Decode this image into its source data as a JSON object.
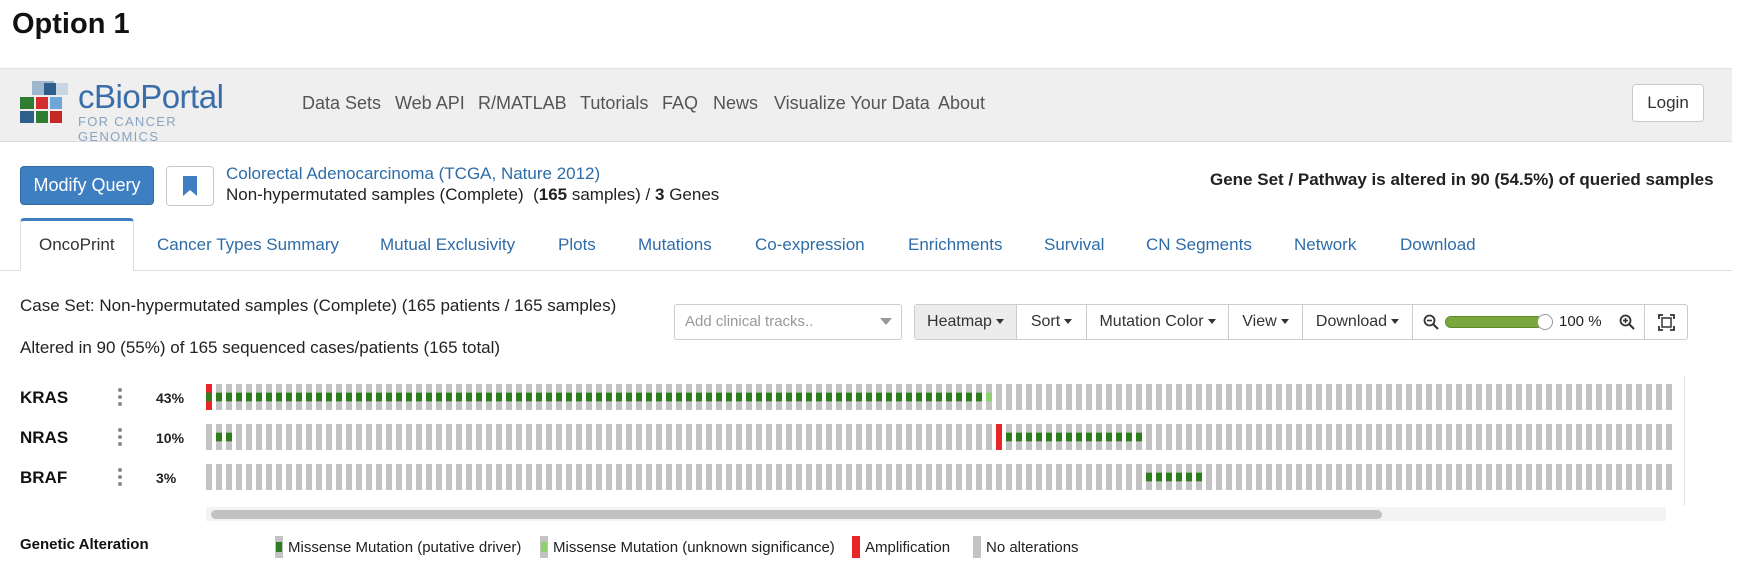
{
  "page": {
    "option_title": "Option 1"
  },
  "navbar": {
    "logo_title": "cBioPortal",
    "logo_subtitle": "FOR CANCER GENOMICS",
    "links": [
      "Data Sets",
      "Web API",
      "R/MATLAB",
      "Tutorials",
      "FAQ",
      "News",
      "Visualize Your Data",
      "About"
    ],
    "login_label": "Login"
  },
  "query": {
    "modify_label": "Modify Query",
    "bookmark_icon": "bookmark-icon",
    "study_title": "Colorectal Adenocarcinoma (TCGA, Nature 2012)",
    "sample_set": "Non-hypermutated samples (Complete)",
    "samples_count": "165",
    "samples_word": "samples) /",
    "genes_count": "3",
    "genes_word": "Genes",
    "altered_summary": "Gene Set / Pathway is altered in 90 (54.5%) of queried samples"
  },
  "tabs": [
    "OncoPrint",
    "Cancer Types Summary",
    "Mutual Exclusivity",
    "Plots",
    "Mutations",
    "Co-expression",
    "Enrichments",
    "Survival",
    "CN Segments",
    "Network",
    "Download"
  ],
  "active_tab": "OncoPrint",
  "oncoprint": {
    "case_set": "Case Set: Non-hypermutated samples (Complete) (165 patients / 165 samples)",
    "altered_cases": "Altered in 90 (55%) of 165 sequenced cases/patients (165 total)",
    "clinical_placeholder": "Add clinical tracks..",
    "toolbar": {
      "heatmap": "Heatmap",
      "sort": "Sort",
      "mutation_color": "Mutation Color",
      "view": "View",
      "download": "Download",
      "zoom_value": "100",
      "zoom_unit": "%"
    },
    "zoom_level_fraction": 0.9,
    "genes": [
      {
        "name": "KRAS",
        "pct": "43%"
      },
      {
        "name": "NRAS",
        "pct": "10%"
      },
      {
        "name": "BRAF",
        "pct": "3%"
      }
    ],
    "scroll_fraction_visible": 0.8
  },
  "legend": {
    "title": "Genetic Alteration",
    "items": [
      {
        "label": "Missense Mutation (putative driver)",
        "color": "#2e7d1f",
        "key": "driver"
      },
      {
        "label": "Missense Mutation (unknown significance)",
        "color": "#8ed16f",
        "key": "vus"
      },
      {
        "label": "Amplification",
        "color": "#e8262a",
        "key": "amp"
      },
      {
        "label": "No alterations",
        "color": "#c3c3c3",
        "key": "none"
      }
    ]
  },
  "colors": {
    "accent": "#3d7fc1",
    "link": "#2e6ca8",
    "no_alteration": "#c3c3c3",
    "driver": "#2e7d1f",
    "vus": "#8ed16f",
    "amplification": "#e8262a"
  }
}
